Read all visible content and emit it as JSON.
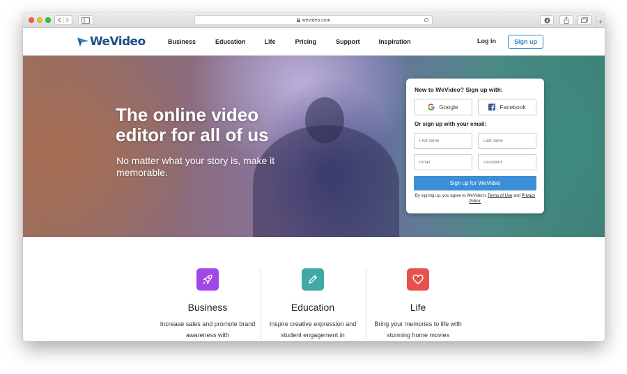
{
  "browser": {
    "url": "wevideo.com"
  },
  "nav": {
    "logo_text": "WeVideo",
    "links": [
      "Business",
      "Education",
      "Life",
      "Pricing",
      "Support",
      "Inspiration"
    ],
    "login_label": "Log in",
    "signup_label": "Sign up"
  },
  "hero": {
    "title": "The online video editor for all of us",
    "subtitle": "No matter what your story is, make it memorable."
  },
  "signup_card": {
    "heading": "New to WeVideo? Sign up with:",
    "google_label": "Google",
    "facebook_label": "Facebook",
    "or_email": "Or sign up with your email:",
    "first_name_placeholder": "First name",
    "last_name_placeholder": "Last name",
    "email_placeholder": "Email",
    "password_placeholder": "Password",
    "submit_label": "Sign up for WeVideo",
    "terms_prefix": "By signing up, you agree to WeVideo's",
    "terms_link": "Terms of Use",
    "terms_and": "and",
    "privacy_link": "Privacy Policy."
  },
  "features": [
    {
      "title": "Business",
      "desc": "Increase sales and promote brand awareness with",
      "color": "#a147e6"
    },
    {
      "title": "Education",
      "desc": "Inspire creative expression and student engagement in",
      "color": "#3fa9a7"
    },
    {
      "title": "Life",
      "desc": "Bring your memories to life with stunning home movies",
      "color": "#e5524e"
    }
  ],
  "colors": {
    "brand_blue": "#2f86c8",
    "button_blue": "#3b8fd6",
    "logo_navy": "#1b4f8c"
  }
}
